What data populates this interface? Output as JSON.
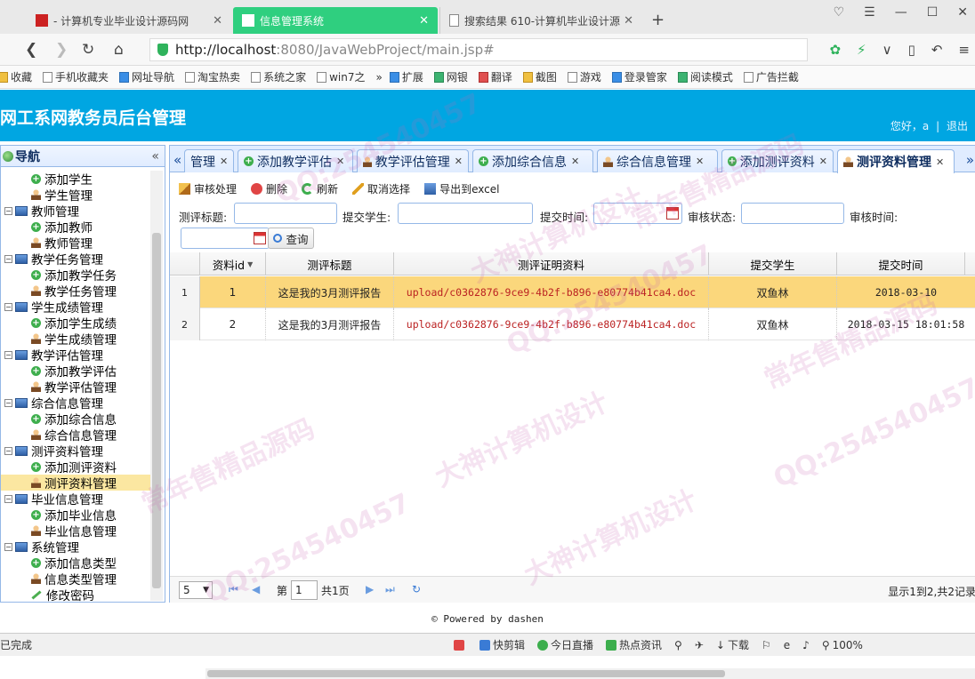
{
  "browser": {
    "tabs": [
      {
        "title": "- 计算机专业毕业设计源码网"
      },
      {
        "title": "信息管理系统"
      },
      {
        "title": "搜索结果 610-计算机毕业设计源"
      }
    ],
    "new_tab": "+",
    "url_host": "http://localhost",
    "url_rest": ":8080/JavaWebProject/main.jsp#",
    "bookmarks": [
      "收藏",
      "手机收藏夹",
      "网址导航",
      "淘宝热卖",
      "系统之家",
      "win7之",
      "扩展",
      "网银",
      "翻译",
      "截图",
      "游戏",
      "登录管家",
      "阅读模式",
      "广告拦截"
    ]
  },
  "header": {
    "title": "网工系网教务员后台管理",
    "greeting": "您好，a",
    "separator": "|",
    "logout": "退出"
  },
  "sidebar": {
    "title": "导航",
    "collapse": "«",
    "items": [
      {
        "label": "添加学生",
        "level": 2,
        "icon": "add-icon"
      },
      {
        "label": "学生管理",
        "level": 2,
        "icon": "user-icon"
      },
      {
        "label": "教师管理",
        "level": 1,
        "icon": "computer-icon"
      },
      {
        "label": "添加教师",
        "level": 2,
        "icon": "add-icon"
      },
      {
        "label": "教师管理",
        "level": 2,
        "icon": "user-icon"
      },
      {
        "label": "教学任务管理",
        "level": 1,
        "icon": "computer-icon"
      },
      {
        "label": "添加教学任务",
        "level": 2,
        "icon": "add-icon"
      },
      {
        "label": "教学任务管理",
        "level": 2,
        "icon": "user-icon"
      },
      {
        "label": "学生成绩管理",
        "level": 1,
        "icon": "computer-icon"
      },
      {
        "label": "添加学生成绩",
        "level": 2,
        "icon": "add-icon"
      },
      {
        "label": "学生成绩管理",
        "level": 2,
        "icon": "user-icon"
      },
      {
        "label": "教学评估管理",
        "level": 1,
        "icon": "computer-icon"
      },
      {
        "label": "添加教学评估",
        "level": 2,
        "icon": "add-icon"
      },
      {
        "label": "教学评估管理",
        "level": 2,
        "icon": "user-icon"
      },
      {
        "label": "综合信息管理",
        "level": 1,
        "icon": "computer-icon"
      },
      {
        "label": "添加综合信息",
        "level": 2,
        "icon": "add-icon"
      },
      {
        "label": "综合信息管理",
        "level": 2,
        "icon": "user-icon"
      },
      {
        "label": "测评资料管理",
        "level": 1,
        "icon": "computer-icon"
      },
      {
        "label": "添加测评资料",
        "level": 2,
        "icon": "add-icon"
      },
      {
        "label": "测评资料管理",
        "level": 2,
        "icon": "user-icon",
        "selected": true
      },
      {
        "label": "毕业信息管理",
        "level": 1,
        "icon": "computer-icon"
      },
      {
        "label": "添加毕业信息",
        "level": 2,
        "icon": "add-icon"
      },
      {
        "label": "毕业信息管理",
        "level": 2,
        "icon": "user-icon"
      },
      {
        "label": "系统管理",
        "level": 1,
        "icon": "computer-icon"
      },
      {
        "label": "添加信息类型",
        "level": 2,
        "icon": "add-icon"
      },
      {
        "label": "信息类型管理",
        "level": 2,
        "icon": "user-icon"
      },
      {
        "label": "修改密码",
        "level": 2,
        "icon": "pencil-icon"
      }
    ]
  },
  "panel_tabs": [
    {
      "label": "管理",
      "icon": "none"
    },
    {
      "label": "添加教学评估",
      "icon": "add-icon"
    },
    {
      "label": "教学评估管理",
      "icon": "user-icon"
    },
    {
      "label": "添加综合信息",
      "icon": "add-icon"
    },
    {
      "label": "综合信息管理",
      "icon": "user-icon"
    },
    {
      "label": "添加测评资料",
      "icon": "add-icon"
    },
    {
      "label": "测评资料管理",
      "icon": "user-icon",
      "active": true
    }
  ],
  "toolbar": {
    "audit": "审核处理",
    "delete": "删除",
    "refresh": "刷新",
    "unselect": "取消选择",
    "export": "导出到excel"
  },
  "search": {
    "title_label": "测评标题:",
    "student_label": "提交学生:",
    "time_label": "提交时间:",
    "status_label": "审核状态:",
    "audit_time_label": "审核时间:",
    "button": "查询"
  },
  "grid": {
    "columns": [
      "资料id",
      "测评标题",
      "测评证明资料",
      "提交学生",
      "提交时间"
    ],
    "rows": [
      {
        "num": "1",
        "id": "1",
        "title": "这是我的3月测评报告",
        "file": "upload/c0362876-9ce9-4b2f-b896-e80774b41ca4.doc",
        "student": "双鱼林",
        "time": "2018-03-10"
      },
      {
        "num": "2",
        "id": "2",
        "title": "这是我的3月测评报告",
        "file": "upload/c0362876-9ce9-4b2f-b896-e80774b41ca4.doc",
        "student": "双鱼林",
        "time": "2018-03-15 18:01:58"
      }
    ]
  },
  "pager": {
    "page_size": "5",
    "page_prefix": "第",
    "page_value": "1",
    "page_suffix": "共1页",
    "info": "显示1到2,共2记录"
  },
  "footer": "© Powered by dashen",
  "statusbar": {
    "left": "已完成",
    "items": [
      "快剪辑",
      "今日直播",
      "热点资讯",
      "下载",
      "100%"
    ]
  },
  "watermarks": [
    "QQ:254540457",
    "常年售精品源码",
    "大神计算机设计",
    "QQ:254540457",
    "常年售精品源码",
    "大神计算机设计",
    "QQ:254540457",
    "常年售精品源码",
    "QQ:254540457",
    "大神计算机设计"
  ]
}
